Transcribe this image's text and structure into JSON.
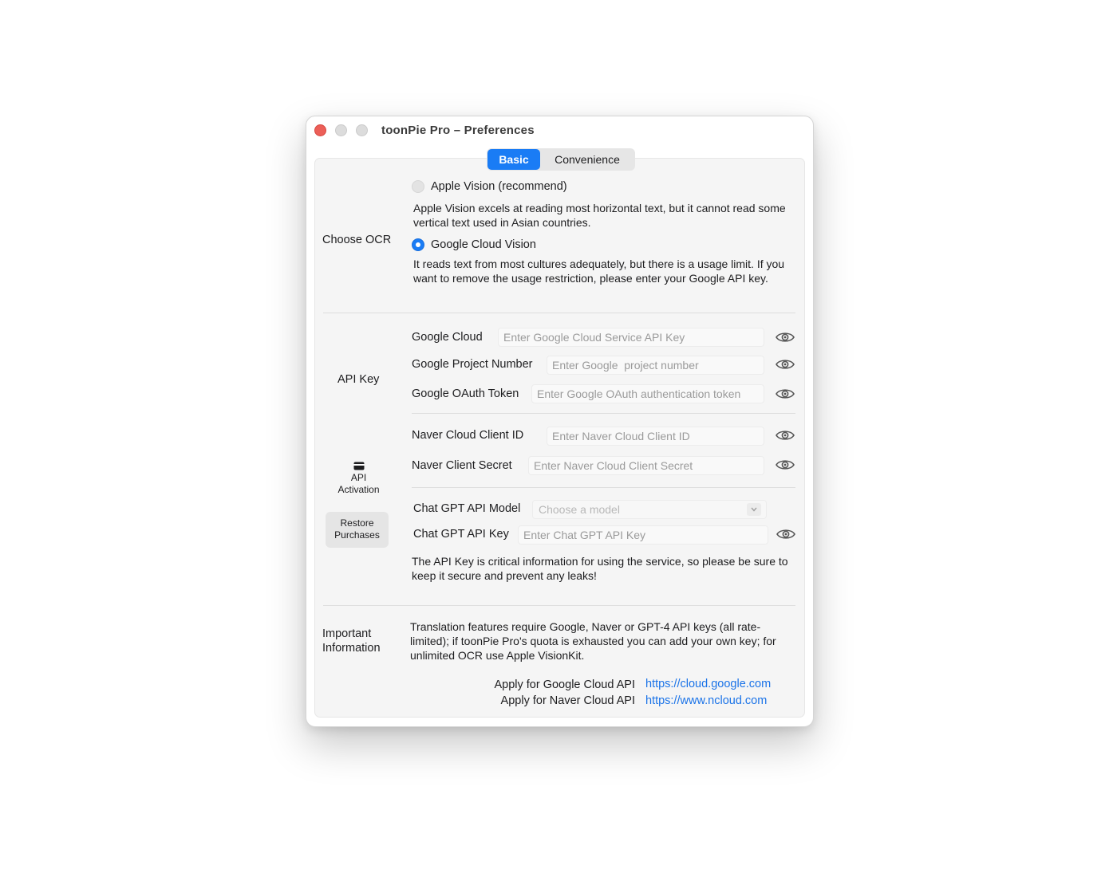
{
  "window": {
    "title": "toonPie Pro  – Preferences"
  },
  "tabs": [
    {
      "label": "Basic",
      "active": true
    },
    {
      "label": "Convenience",
      "active": false
    }
  ],
  "ocr": {
    "section_label": "Choose OCR",
    "apple": {
      "label": "Apple Vision (recommend)",
      "selected": false,
      "description": "Apple Vision excels at reading most horizontal text, but it cannot read some vertical text used in Asian countries."
    },
    "google": {
      "label": "Google Cloud Vision",
      "selected": true,
      "description": "It reads text from most cultures adequately, but there is a usage limit. If you want to remove the usage restriction, please enter your Google API key."
    }
  },
  "api": {
    "section_label": "API Key",
    "google_cloud": {
      "label": "Google Cloud",
      "placeholder": "Enter Google Cloud Service API Key",
      "value": ""
    },
    "google_project": {
      "label": "Google Project Number",
      "placeholder": "Enter Google  project number",
      "value": ""
    },
    "google_oauth": {
      "label": "Google OAuth Token",
      "placeholder": "Enter Google OAuth authentication token",
      "value": ""
    },
    "naver_id": {
      "label": "Naver Cloud Client ID",
      "placeholder": "Enter Naver Cloud Client ID",
      "value": ""
    },
    "naver_secret": {
      "label": "Naver Client Secret",
      "placeholder": "Enter Naver Cloud Client Secret",
      "value": ""
    },
    "gpt_model": {
      "label": "Chat GPT API Model",
      "placeholder": "Choose a model"
    },
    "gpt_key": {
      "label": "Chat GPT API Key",
      "placeholder": "Enter Chat GPT API Key",
      "value": ""
    },
    "warning": "The API Key is critical information for using the service, so please be sure to keep it secure and prevent any leaks!"
  },
  "sidebar": {
    "activation_label_line1": "API",
    "activation_label_line2": "Activation",
    "restore_line1": "Restore",
    "restore_line2": "Purchases"
  },
  "info": {
    "section_label_line1": "Important",
    "section_label_line2": "Information",
    "text": "Translation features require Google, Naver or GPT-4 API keys (all rate-limited); if toonPie Pro's quota is exhausted you can add your own key; for unlimited OCR use Apple VisionKit.",
    "google_apply_label": "Apply for Google Cloud API",
    "google_link": "https://cloud.google.com",
    "naver_apply_label": "Apply for Naver Cloud API",
    "naver_link": "https://www.ncloud.com"
  },
  "icons": {
    "eye": "eye-icon",
    "card": "credit-card-icon",
    "chevron": "chevron-down-icon"
  },
  "colors": {
    "accent": "#1a7cf5",
    "link": "#1a73e8",
    "close": "#ec5f58"
  }
}
